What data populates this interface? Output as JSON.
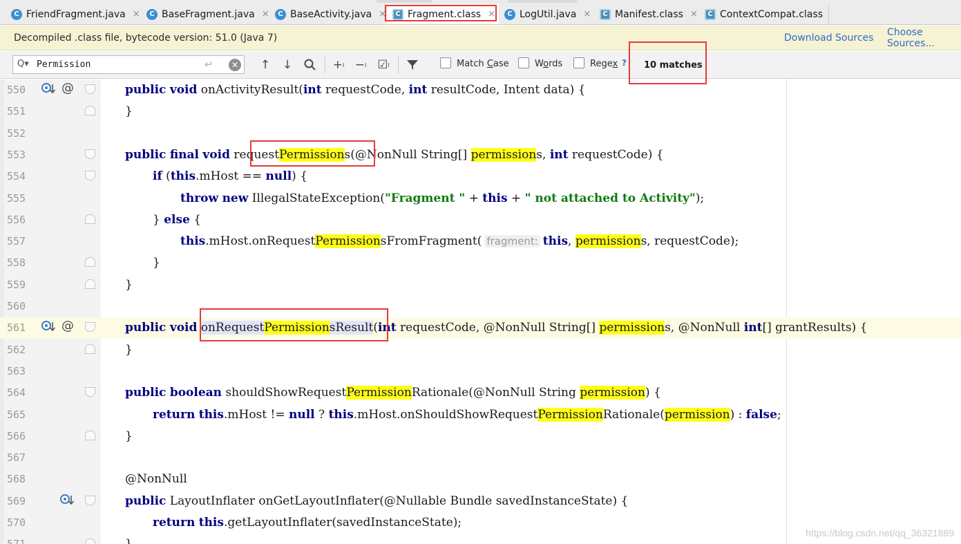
{
  "tabs": [
    {
      "label": "FriendFragment.java",
      "icon": "C",
      "icon_kind": "class-icon"
    },
    {
      "label": "BaseFragment.java",
      "icon": "C",
      "icon_kind": "class-icon"
    },
    {
      "label": "BaseActivity.java",
      "icon": "C",
      "icon_kind": "class-icon"
    },
    {
      "label": "Fragment.class",
      "icon": "C",
      "icon_kind": "library-class-icon"
    },
    {
      "label": "LogUtil.java",
      "icon": "C",
      "icon_kind": "class-icon"
    },
    {
      "label": "Manifest.class",
      "icon": "C",
      "icon_kind": "library-class-icon"
    },
    {
      "label": "ContextCompat.class",
      "icon": "C",
      "icon_kind": "library-class-icon"
    }
  ],
  "tab_close_glyph": "×",
  "banner": {
    "message": "Decompiled .class file, bytecode version: 51.0 (Java 7)",
    "download_sources": "Download Sources",
    "choose_sources": "Choose Sources..."
  },
  "search": {
    "value": "Permission",
    "prefix_glyph": "Q▾",
    "enter_glyph": "↵",
    "clear_glyph": "✕",
    "match_case": {
      "pre": "Match ",
      "u": "C",
      "post": "ase",
      "checked": false
    },
    "words": {
      "pre": "W",
      "u": "o",
      "post": "rds",
      "checked": false
    },
    "regex": {
      "pre": "Rege",
      "u": "x",
      "post": "",
      "checked": false
    },
    "help": "?",
    "matches": "10 matches"
  },
  "colors": {
    "search_highlight": "#ffff1a",
    "keyword": "#000080",
    "string": "#117a11",
    "annotation_box": "#e23b3b",
    "banner_bg": "#f6f2d4",
    "link": "#2e6bc8"
  },
  "editor": {
    "current_line": "561",
    "watermark": "https://blog.csdn.net/qq_36321889",
    "lines": [
      {
        "num": "550",
        "icons": [
          "override-down-icon",
          "at-icon"
        ],
        "fold": "open",
        "indent": 0,
        "tokens": [
          [
            "kw",
            "public"
          ],
          [
            "t",
            " "
          ],
          [
            "kw",
            "void"
          ],
          [
            "t",
            " onActivityResult("
          ],
          [
            "kw",
            "int"
          ],
          [
            "t",
            " requestCode, "
          ],
          [
            "kw",
            "int"
          ],
          [
            "t",
            " resultCode, Intent data) {"
          ]
        ]
      },
      {
        "num": "551",
        "icons": [],
        "fold": "close",
        "indent": 0,
        "tokens": [
          [
            "t",
            "}"
          ]
        ]
      },
      {
        "num": "552",
        "icons": [],
        "fold": "",
        "indent": 0,
        "tokens": []
      },
      {
        "num": "553",
        "icons": [],
        "fold": "open",
        "indent": 0,
        "tokens": [
          [
            "kw",
            "public"
          ],
          [
            "t",
            " "
          ],
          [
            "kw",
            "final"
          ],
          [
            "t",
            " "
          ],
          [
            "kw",
            "void"
          ],
          [
            "t",
            " request"
          ],
          [
            "hl",
            "Permission"
          ],
          [
            "t",
            "s(@NonNull String[] "
          ],
          [
            "hl",
            "permission"
          ],
          [
            "t",
            "s, "
          ],
          [
            "kw",
            "int"
          ],
          [
            "t",
            " requestCode) {"
          ]
        ]
      },
      {
        "num": "554",
        "icons": [],
        "fold": "open",
        "indent": 1,
        "tokens": [
          [
            "kw",
            "if"
          ],
          [
            "t",
            " ("
          ],
          [
            "kw",
            "this"
          ],
          [
            "t",
            ".mHost == "
          ],
          [
            "kw",
            "null"
          ],
          [
            "t",
            ") {"
          ]
        ]
      },
      {
        "num": "555",
        "icons": [],
        "fold": "",
        "indent": 2,
        "tokens": [
          [
            "kw",
            "throw"
          ],
          [
            "t",
            " "
          ],
          [
            "kw",
            "new"
          ],
          [
            "t",
            " IllegalStateException("
          ],
          [
            "str",
            "\"Fragment \""
          ],
          [
            "t",
            " + "
          ],
          [
            "kw",
            "this"
          ],
          [
            "t",
            " + "
          ],
          [
            "str",
            "\" not attached to Activity\""
          ],
          [
            "t",
            ");"
          ]
        ]
      },
      {
        "num": "556",
        "icons": [],
        "fold": "close",
        "indent": 1,
        "tokens": [
          [
            "t",
            "} "
          ],
          [
            "kw",
            "else"
          ],
          [
            "t",
            " {"
          ]
        ]
      },
      {
        "num": "557",
        "icons": [],
        "fold": "",
        "indent": 2,
        "tokens": [
          [
            "kw",
            "this"
          ],
          [
            "t",
            ".mHost.onRequest"
          ],
          [
            "hl",
            "Permission"
          ],
          [
            "t",
            "sFromFragment("
          ],
          [
            "hint",
            "fragment:"
          ],
          [
            "kw",
            "this"
          ],
          [
            "t",
            ", "
          ],
          [
            "hl",
            "permission"
          ],
          [
            "t",
            "s, requestCode);"
          ]
        ]
      },
      {
        "num": "558",
        "icons": [],
        "fold": "close",
        "indent": 1,
        "tokens": [
          [
            "t",
            "}"
          ]
        ]
      },
      {
        "num": "559",
        "icons": [],
        "fold": "close",
        "indent": 0,
        "tokens": [
          [
            "t",
            "}"
          ]
        ]
      },
      {
        "num": "560",
        "icons": [],
        "fold": "",
        "indent": 0,
        "tokens": []
      },
      {
        "num": "561",
        "icons": [
          "override-down-icon",
          "at-icon"
        ],
        "fold": "open",
        "indent": 0,
        "tokens": [
          [
            "kw",
            "public"
          ],
          [
            "t",
            " "
          ],
          [
            "kw",
            "void"
          ],
          [
            "t",
            " "
          ],
          [
            "sel",
            "onRequest"
          ],
          [
            "hl",
            "Permission"
          ],
          [
            "sel",
            "sResult"
          ],
          [
            "t",
            "("
          ],
          [
            "kw",
            "int"
          ],
          [
            "t",
            " requestCode, @NonNull String[] "
          ],
          [
            "hl",
            "permission"
          ],
          [
            "t",
            "s, @NonNull "
          ],
          [
            "kw",
            "int"
          ],
          [
            "t",
            "[] grantResults) {"
          ]
        ]
      },
      {
        "num": "562",
        "icons": [],
        "fold": "close",
        "indent": 0,
        "tokens": [
          [
            "t",
            "}"
          ]
        ]
      },
      {
        "num": "563",
        "icons": [],
        "fold": "",
        "indent": 0,
        "tokens": []
      },
      {
        "num": "564",
        "icons": [],
        "fold": "open",
        "indent": 0,
        "tokens": [
          [
            "kw",
            "public"
          ],
          [
            "t",
            " "
          ],
          [
            "kw",
            "boolean"
          ],
          [
            "t",
            " shouldShowRequest"
          ],
          [
            "hl",
            "Permission"
          ],
          [
            "t",
            "Rationale(@NonNull String "
          ],
          [
            "hl",
            "permission"
          ],
          [
            "t",
            ") {"
          ]
        ]
      },
      {
        "num": "565",
        "icons": [],
        "fold": "",
        "indent": 1,
        "tokens": [
          [
            "kw",
            "return"
          ],
          [
            "t",
            " "
          ],
          [
            "kw",
            "this"
          ],
          [
            "t",
            ".mHost != "
          ],
          [
            "kw",
            "null"
          ],
          [
            "t",
            " ? "
          ],
          [
            "kw",
            "this"
          ],
          [
            "t",
            ".mHost.onShouldShowRequest"
          ],
          [
            "hl",
            "Permission"
          ],
          [
            "t",
            "Rationale("
          ],
          [
            "hl",
            "permission"
          ],
          [
            "t",
            ") : "
          ],
          [
            "kw",
            "false"
          ],
          [
            "t",
            ";"
          ]
        ]
      },
      {
        "num": "566",
        "icons": [],
        "fold": "close",
        "indent": 0,
        "tokens": [
          [
            "t",
            "}"
          ]
        ]
      },
      {
        "num": "567",
        "icons": [],
        "fold": "",
        "indent": 0,
        "tokens": []
      },
      {
        "num": "568",
        "icons": [],
        "fold": "",
        "indent": 0,
        "tokens": [
          [
            "t",
            "@NonNull"
          ]
        ]
      },
      {
        "num": "569",
        "icons": [
          "override-down-icon"
        ],
        "fold": "open",
        "indent": 0,
        "tokens": [
          [
            "kw",
            "public"
          ],
          [
            "t",
            " LayoutInflater onGetLayoutInflater(@Nullable Bundle savedInstanceState) {"
          ]
        ]
      },
      {
        "num": "570",
        "icons": [],
        "fold": "",
        "indent": 1,
        "tokens": [
          [
            "kw",
            "return"
          ],
          [
            "t",
            " "
          ],
          [
            "kw",
            "this"
          ],
          [
            "t",
            ".getLayoutInflater(savedInstanceState);"
          ]
        ]
      },
      {
        "num": "571",
        "icons": [],
        "fold": "close",
        "indent": 0,
        "tokens": [
          [
            "t",
            "}"
          ]
        ]
      }
    ]
  }
}
